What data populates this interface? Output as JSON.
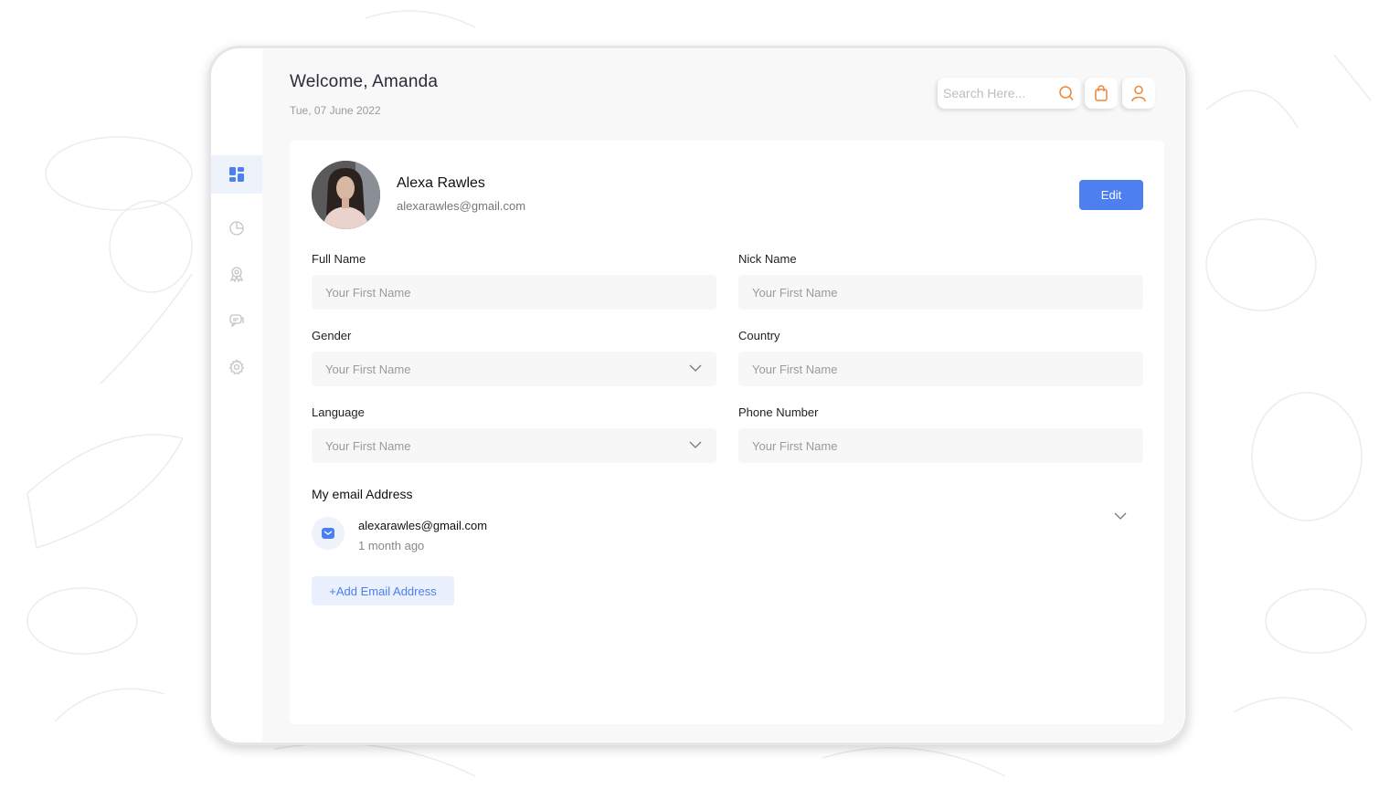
{
  "header": {
    "title": "Welcome, Amanda",
    "date": "Tue, 07 June 2022"
  },
  "search": {
    "placeholder": "Search Here..."
  },
  "profile": {
    "name": "Alexa Rawles",
    "email": "alexarawles@gmail.com",
    "edit_label": "Edit"
  },
  "form": {
    "fields": [
      {
        "label": "Full Name",
        "placeholder": "Your First Name",
        "dropdown": false
      },
      {
        "label": "Nick Name",
        "placeholder": "Your First Name",
        "dropdown": false
      },
      {
        "label": "Gender",
        "placeholder": "Your First Name",
        "dropdown": true
      },
      {
        "label": "Country",
        "placeholder": "Your First Name",
        "dropdown": false
      },
      {
        "label": "Language",
        "placeholder": "Your First Name",
        "dropdown": true
      },
      {
        "label": "Phone Number",
        "placeholder": "Your First Name",
        "dropdown": false
      }
    ]
  },
  "email_section": {
    "title": "My email Address",
    "email": "alexarawles@gmail.com",
    "time": "1 month ago",
    "add_label": "+Add Email Address"
  },
  "sidebar": {
    "items": [
      {
        "icon": "dashboard-icon",
        "active": true
      },
      {
        "icon": "pie-chart-icon",
        "active": false
      },
      {
        "icon": "award-icon",
        "active": false
      },
      {
        "icon": "chat-icon",
        "active": false
      },
      {
        "icon": "gear-icon",
        "active": false
      }
    ]
  },
  "colors": {
    "accent": "#4d7ff0",
    "orange": "#f08a3c",
    "card_bg": "#ffffff",
    "field_bg": "#f7f7f8"
  }
}
